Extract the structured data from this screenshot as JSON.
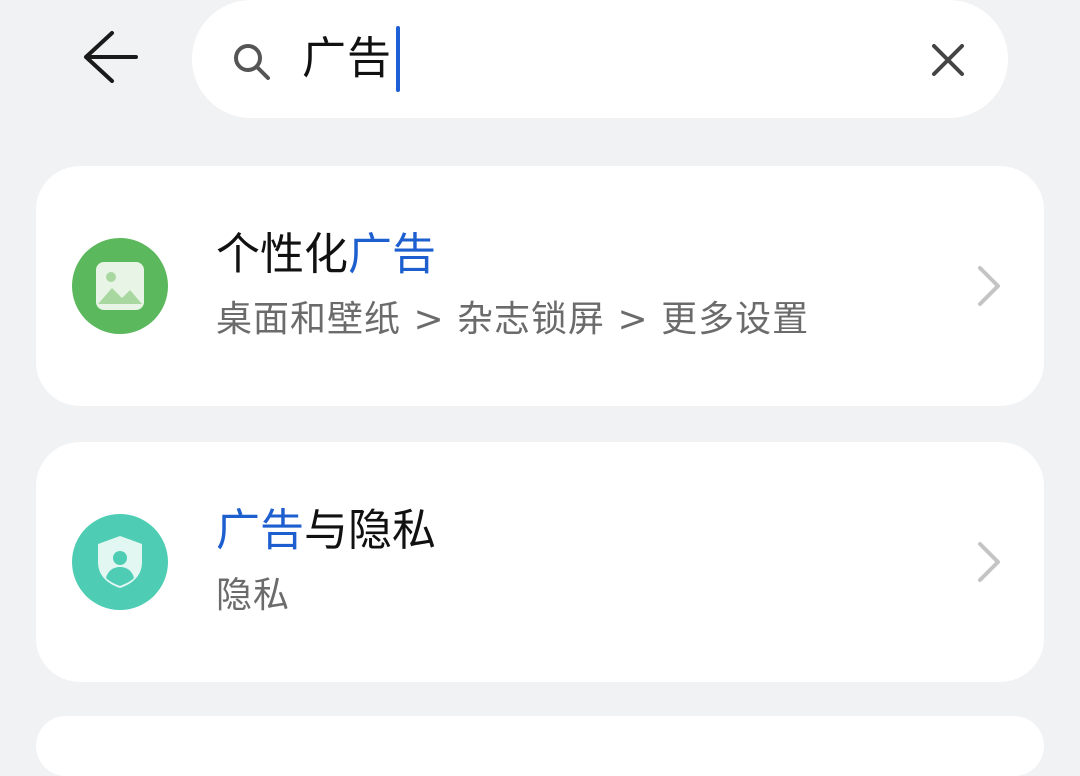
{
  "header": {
    "back_icon": "arrow-left-icon",
    "search": {
      "query": "广告",
      "search_icon": "search-icon",
      "clear_icon": "close-icon"
    }
  },
  "results": [
    {
      "title_prefix": "个性化",
      "title_highlight": "广告",
      "title_suffix": "",
      "path": "桌面和壁纸 > 杂志锁屏 > 更多设置",
      "icon": "image-icon",
      "icon_color": "#5cb85c"
    },
    {
      "title_prefix": "",
      "title_highlight": "广告",
      "title_suffix": "与隐私",
      "path": "隐私",
      "icon": "privacy-shield-icon",
      "icon_color": "#4ecdb4"
    }
  ],
  "colors": {
    "highlight": "#1e5fd0",
    "background": "#f1f2f4",
    "caret": "#1f5fd6"
  }
}
